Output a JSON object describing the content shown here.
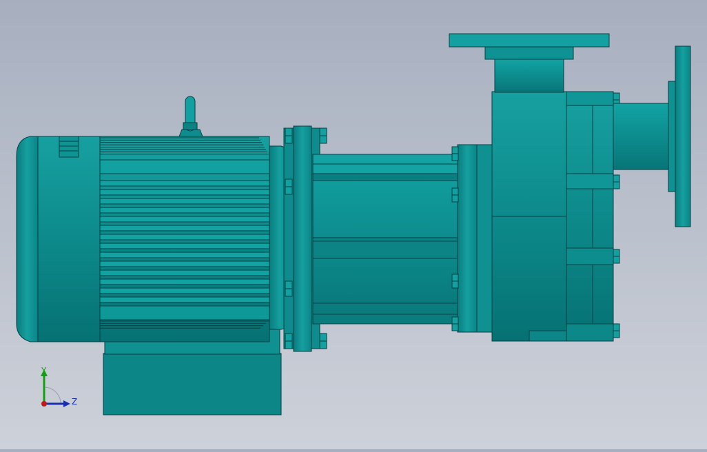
{
  "scene": {
    "background_top": "#a7afbf",
    "background_bottom": "#cdd1d9",
    "model_color": "#0f8c8c",
    "model_color_dark": "#066a6c",
    "model_color_light": "#1aa3a3",
    "edge_color": "#063f42",
    "parts": [
      "motor",
      "motor-fan-cover",
      "lifting-eye",
      "motor-base",
      "coupling-flange",
      "bearing-bracket",
      "pump-casing",
      "discharge-flange",
      "suction-flange"
    ]
  },
  "triad": {
    "y_label": "Y",
    "z_label": "Z",
    "y_color": "#12a012",
    "z_color": "#1a2fb0",
    "origin_color": "#c01818"
  }
}
